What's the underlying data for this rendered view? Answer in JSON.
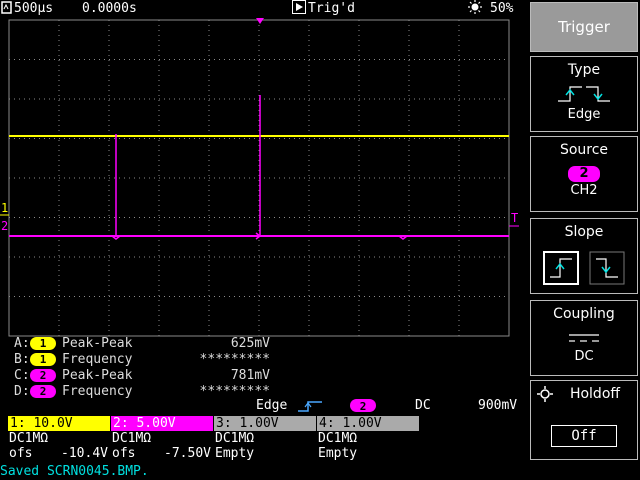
{
  "topbar": {
    "timebase": "500µs",
    "position": "0.0000s",
    "run_state": "Trig'd",
    "brightness": "50%"
  },
  "screen": {
    "ch1_marker": "1",
    "ch2_marker": "2",
    "trigger_marker": "T",
    "colors": {
      "ch1": "#ffff00",
      "ch2": "#ff00ff",
      "grid": "#8a8a8a"
    }
  },
  "measures": [
    {
      "key": "A:",
      "channel": "1",
      "name": "Peak-Peak",
      "value": "625mV"
    },
    {
      "key": "B:",
      "channel": "1",
      "name": "Frequency",
      "value": "*********"
    },
    {
      "key": "C:",
      "channel": "2",
      "name": "Peak-Peak",
      "value": "781mV"
    },
    {
      "key": "D:",
      "channel": "2",
      "name": "Frequency",
      "value": "*********"
    }
  ],
  "trigger_info": {
    "mode": "Edge",
    "source": "2",
    "coupling": "DC",
    "level": "900mV"
  },
  "channels": [
    {
      "header": "1: 10.0V",
      "coupling": "DC1MΩ",
      "offset_label": "ofs",
      "offset": "-10.4V"
    },
    {
      "header": "2: 5.00V",
      "coupling": "DC1MΩ",
      "offset_label": "ofs",
      "offset": "-7.50V"
    },
    {
      "header": "3: 1.00V",
      "coupling": "DC1MΩ",
      "state": "Empty"
    },
    {
      "header": "4: 1.00V",
      "coupling": "DC1MΩ",
      "state": "Empty"
    }
  ],
  "status": "Saved SCRN0045.BMP.",
  "menu": {
    "title": "Trigger",
    "type": {
      "label": "Type",
      "value": "Edge"
    },
    "source": {
      "label": "Source",
      "channel": "2",
      "value": "CH2"
    },
    "slope": {
      "label": "Slope"
    },
    "coupling": {
      "label": "Coupling",
      "value": "DC"
    },
    "holdoff": {
      "label": "Holdoff",
      "value": "Off"
    }
  }
}
